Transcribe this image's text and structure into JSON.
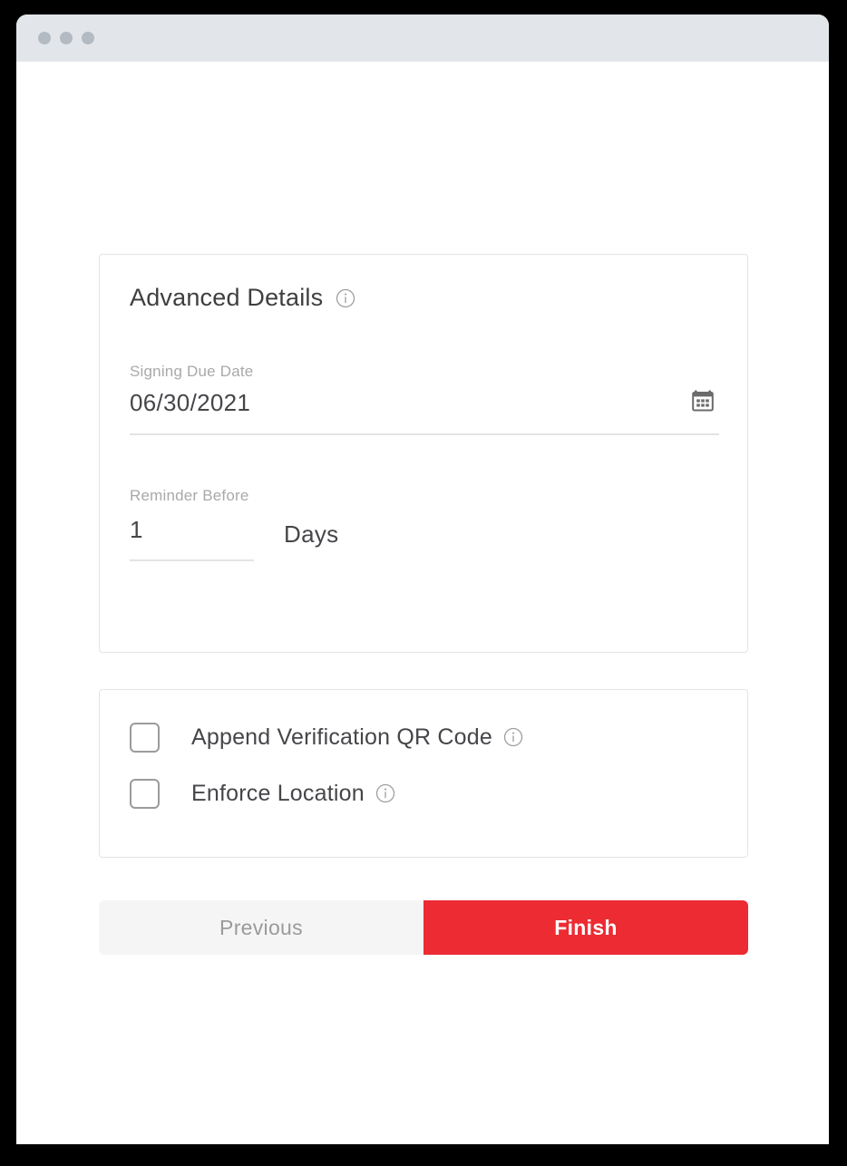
{
  "window": {
    "titlebar": {
      "dots": [
        "traffic-light-1",
        "traffic-light-2",
        "traffic-light-3"
      ],
      "background_color": "#E2E6EA",
      "dot_color": "#B3BAC2"
    }
  },
  "advanced_card": {
    "title": "Advanced Details",
    "title_info_icon": "info-icon",
    "signing_due_date": {
      "label": "Signing Due Date",
      "value": "06/30/2021",
      "placeholder": "MM/DD/YYYY",
      "icon": "calendar-icon"
    },
    "reminder_before": {
      "label": "Reminder Before",
      "value": "1",
      "placeholder": "0",
      "unit": "Days"
    }
  },
  "options_card": {
    "checkboxes": [
      {
        "label": "Append Verification QR Code",
        "checked": false,
        "info_icon": "info-icon"
      },
      {
        "label": "Enforce Location",
        "checked": false,
        "info_icon": "info-icon"
      }
    ]
  },
  "footer": {
    "previous_label": "Previous",
    "finish_label": "Finish",
    "finish_color": "#EC2B33",
    "previous_color": "#F5F5F5"
  }
}
